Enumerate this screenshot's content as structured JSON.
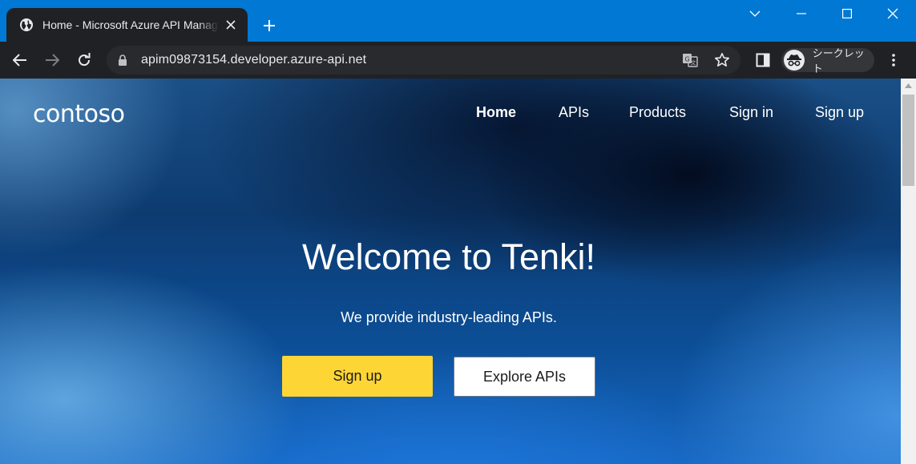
{
  "browser": {
    "tab": {
      "title": "Home - Microsoft Azure API Management",
      "favicon": "globe-icon"
    },
    "address_bar": {
      "url": "apim09873154.developer.azure-api.net"
    },
    "profile": {
      "label": "シークレット"
    },
    "colors": {
      "titlebar": "#0078d4",
      "toolbar": "#202124"
    }
  },
  "site": {
    "logo": "contoso",
    "nav": [
      {
        "label": "Home",
        "active": true
      },
      {
        "label": "APIs",
        "active": false
      },
      {
        "label": "Products",
        "active": false
      },
      {
        "label": "Sign in",
        "active": false
      },
      {
        "label": "Sign up",
        "active": false
      }
    ],
    "hero": {
      "title": "Welcome to Tenki!",
      "subtitle": "We provide industry-leading APIs.",
      "primary_button": "Sign up",
      "secondary_button": "Explore APIs"
    },
    "colors": {
      "primary_button": "#fdd535",
      "secondary_button": "#ffffff"
    }
  }
}
